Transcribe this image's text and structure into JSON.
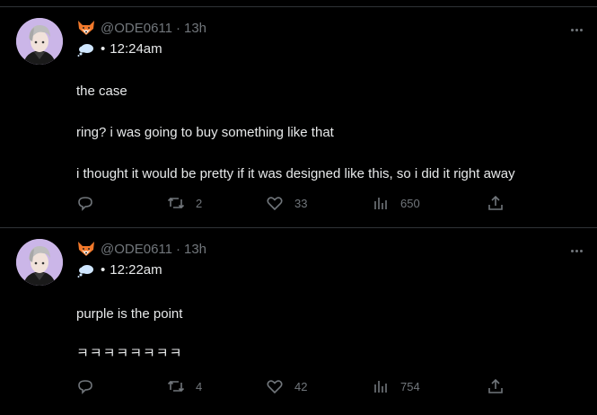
{
  "tweets": [
    {
      "author_handle": "@ODE0611",
      "time_ago": "13h",
      "timestamp": "12:24am",
      "lines": [
        "the case",
        "ring? i was going to buy something like that",
        "i thought it would be pretty if it was designed like this, so i did it right away"
      ],
      "retweets": "2",
      "likes": "33",
      "views": "650"
    },
    {
      "author_handle": "@ODE0611",
      "time_ago": "13h",
      "timestamp": "12:22am",
      "lines": [
        "purple is the point",
        "ㅋㅋㅋㅋㅋㅋㅋㅋ"
      ],
      "retweets": "4",
      "likes": "42",
      "views": "754"
    }
  ],
  "labels": {
    "separator": "·",
    "bullet": "•"
  },
  "colors": {
    "background": "#000000",
    "text": "#e7e9ea",
    "muted": "#71767b",
    "divider": "#2f3336",
    "avatar_bg": "#c8b4e6"
  },
  "icons": [
    "avatar",
    "fox-emoji-icon",
    "cloud-emoji-icon",
    "more-icon",
    "reply-icon",
    "retweet-icon",
    "like-icon",
    "views-icon",
    "share-icon"
  ]
}
